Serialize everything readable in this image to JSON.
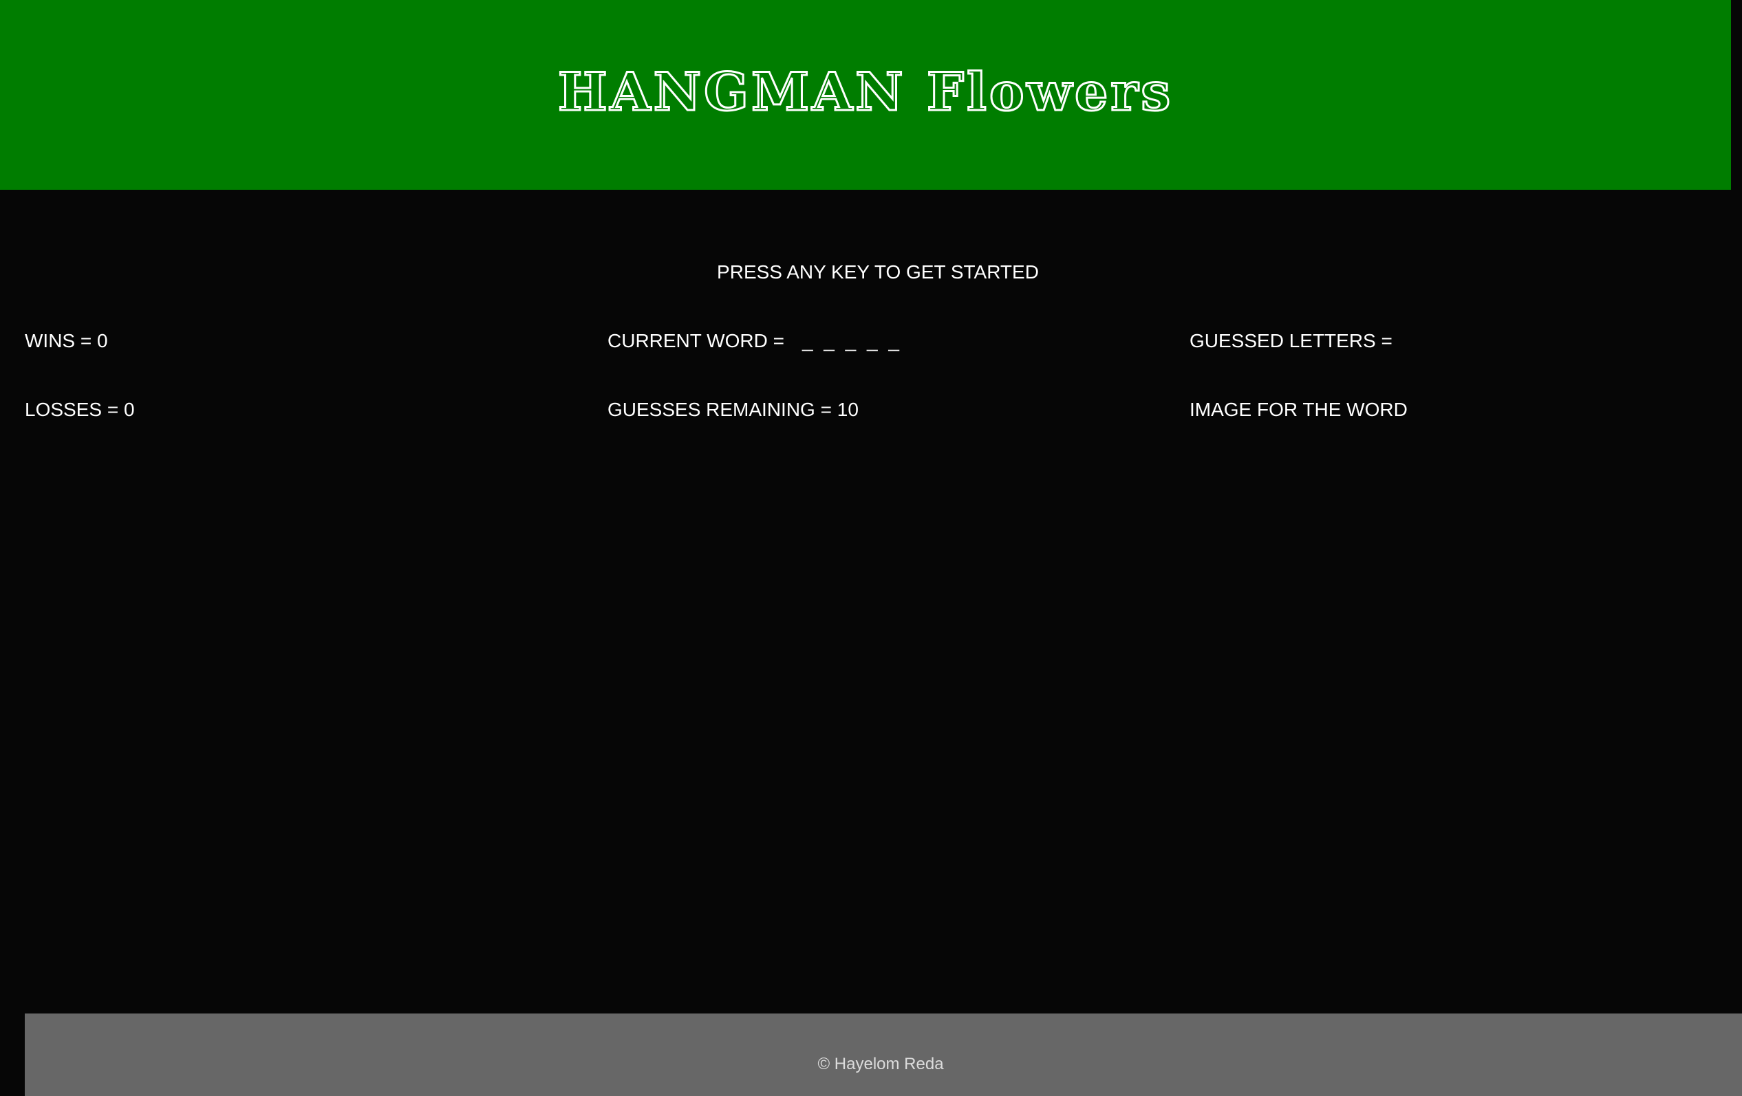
{
  "header": {
    "title": "HANGMAN Flowers"
  },
  "game": {
    "prompt": "PRESS ANY KEY TO GET STARTED",
    "wins_label": "WINS = 0",
    "losses_label": "LOSSES = 0",
    "current_word_label": "CURRENT WORD =",
    "current_word_value": "_ _ _ _ _",
    "guesses_remaining_label": "GUESSES REMAINING = 10",
    "guessed_letters_label": "GUESSED LETTERS =",
    "image_label": "IMAGE FOR THE WORD"
  },
  "footer": {
    "copyright": "© Hayelom Reda"
  },
  "colors": {
    "header_bg": "#007d00",
    "page_bg": "#060606",
    "footer_bg": "#676767",
    "text": "#ffffff"
  }
}
